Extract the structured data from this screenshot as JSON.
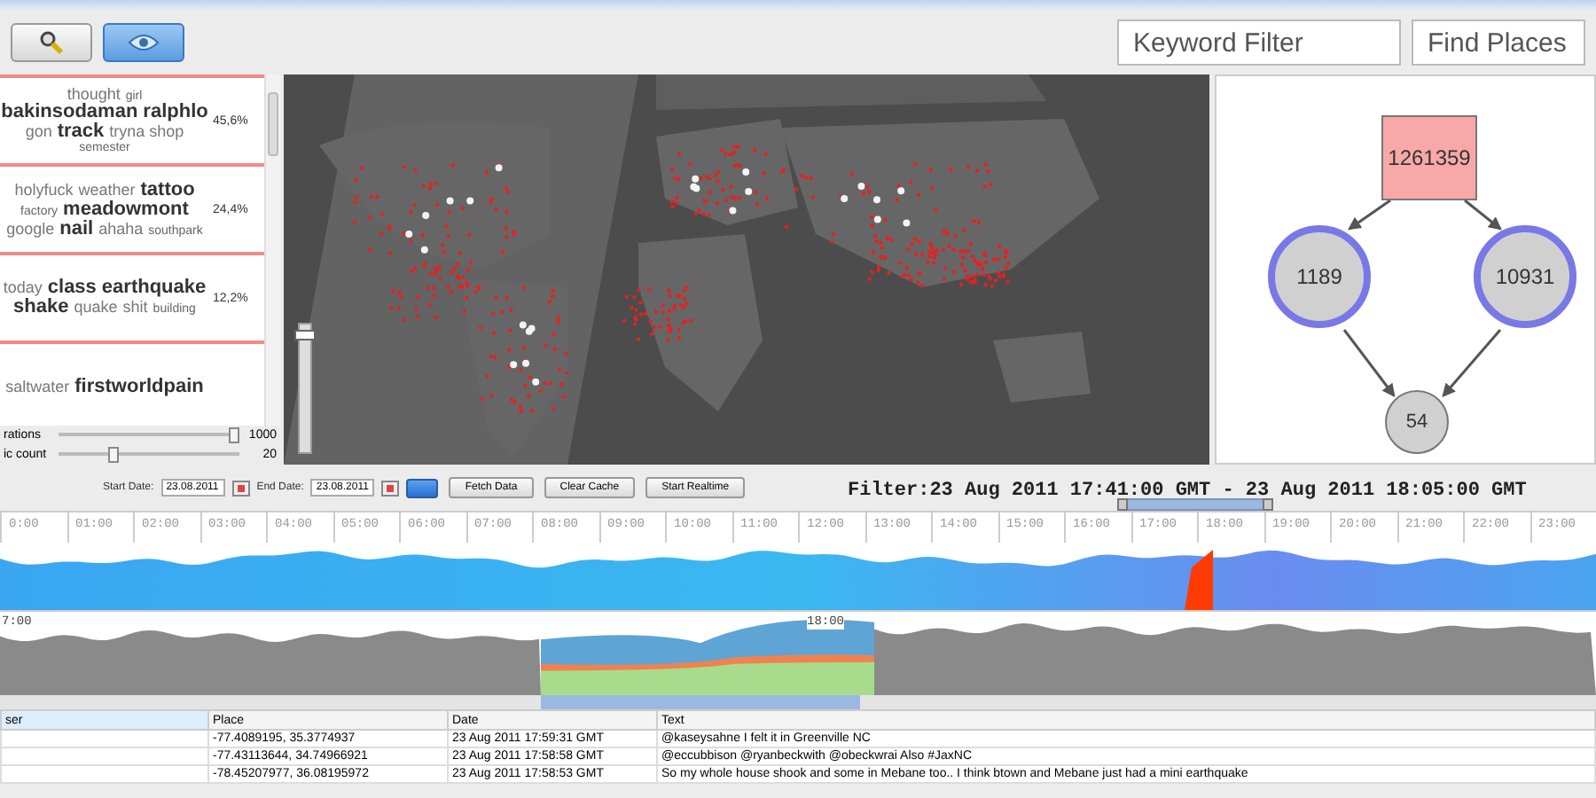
{
  "toolbar": {
    "buttons": [
      {
        "kind": "search",
        "selected": false
      },
      {
        "kind": "eye",
        "selected": true
      }
    ],
    "keyword_filter": {
      "placeholder": "Keyword Filter"
    },
    "find_places": {
      "placeholder": "Find Places"
    }
  },
  "word_cloud": {
    "groups": [
      {
        "share": "45,6%",
        "words": [
          {
            "text": "thought",
            "kind": "medium"
          },
          {
            "text": "girl",
            "kind": "small"
          },
          {
            "text": "bakinsodaman",
            "kind": "large"
          },
          {
            "text": "ralphlo",
            "kind": "large"
          },
          {
            "text": "gon",
            "kind": "medium"
          },
          {
            "text": "track",
            "kind": "large"
          },
          {
            "text": "tryna shop",
            "kind": "medium"
          },
          {
            "text": "semester",
            "kind": "small"
          }
        ]
      },
      {
        "share": "24,4%",
        "words": [
          {
            "text": "holyfuck",
            "kind": "medium"
          },
          {
            "text": "weather",
            "kind": "medium"
          },
          {
            "text": "tattoo",
            "kind": "large"
          },
          {
            "text": "factory",
            "kind": "small"
          },
          {
            "text": "meadowmont",
            "kind": "large"
          },
          {
            "text": "google",
            "kind": "medium"
          },
          {
            "text": "nail",
            "kind": "large"
          },
          {
            "text": "ahaha",
            "kind": "medium"
          },
          {
            "text": "southpark",
            "kind": "small"
          }
        ]
      },
      {
        "share": "12,2%",
        "words": [
          {
            "text": "today",
            "kind": "medium"
          },
          {
            "text": "class",
            "kind": "large"
          },
          {
            "text": "earthquake",
            "kind": "large"
          },
          {
            "text": "shake",
            "kind": "large"
          },
          {
            "text": "quake",
            "kind": "medium"
          },
          {
            "text": "shit",
            "kind": "medium"
          },
          {
            "text": "building",
            "kind": "small"
          }
        ]
      },
      {
        "words": [
          {
            "text": "saltwater",
            "kind": "medium"
          },
          {
            "text": "firstworldpain",
            "kind": "large"
          }
        ]
      }
    ]
  },
  "sliders": [
    {
      "label": "rations",
      "level": 0.97,
      "value": "1000"
    },
    {
      "label": "ic count",
      "level": 0.3,
      "value": "20"
    }
  ],
  "map": {
    "kind": "picture",
    "zoom_slider": {
      "level": 0.95
    }
  },
  "flow_graph": {
    "nodes": [
      {
        "kind": "source",
        "value": "1261359"
      },
      {
        "kind": "filter",
        "value": "1189"
      },
      {
        "kind": "filter",
        "value": "10931"
      },
      {
        "kind": "sink",
        "value": "54"
      }
    ]
  },
  "controls": {
    "start_date": {
      "label": "Start Date:",
      "value": "23.08.2011"
    },
    "end_date": {
      "label": "End Date:",
      "value": "23.08.2011"
    },
    "buttons": [
      "Fetch Data",
      "Clear Cache",
      "Start Realtime"
    ]
  },
  "filter": "Filter:23 Aug 2011 17:41:00 GMT - 23 Aug 2011 18:05:00 GMT",
  "timeline": {
    "hours": [
      "0:00",
      "01:00",
      "02:00",
      "03:00",
      "04:00",
      "05:00",
      "06:00",
      "07:00",
      "08:00",
      "09:00",
      "10:00",
      "11:00",
      "12:00",
      "13:00",
      "14:00",
      "15:00",
      "16:00",
      "17:00",
      "18:00",
      "19:00",
      "20:00",
      "21:00",
      "22:00",
      "23:00"
    ]
  },
  "overview": {
    "labels": [
      "7:00",
      "18:00"
    ]
  },
  "table": {
    "columns": [
      {
        "label": "ser",
        "selected": true
      },
      {
        "label": "Place",
        "selected": false
      },
      {
        "label": "Date",
        "selected": false
      },
      {
        "label": "Text",
        "selected": false
      }
    ],
    "rows": [
      {
        "place": "-77.4089195, 35.3774937",
        "date": "23 Aug 2011 17:59:31 GMT",
        "text": "@kaseysahne I felt it in Greenville NC"
      },
      {
        "place": "-77.43113644, 34.74966921",
        "date": "23 Aug 2011 17:58:58 GMT",
        "text": "@eccubbison @ryanbeckwith @obeckwrai Also #JaxNC"
      },
      {
        "place": "-78.45207977, 36.08195972",
        "date": "23 Aug 2011 17:58:53 GMT",
        "text": "So my whole house shook and some in Mebane too.. I think btown and Mebane just had a mini earthquake"
      }
    ]
  }
}
